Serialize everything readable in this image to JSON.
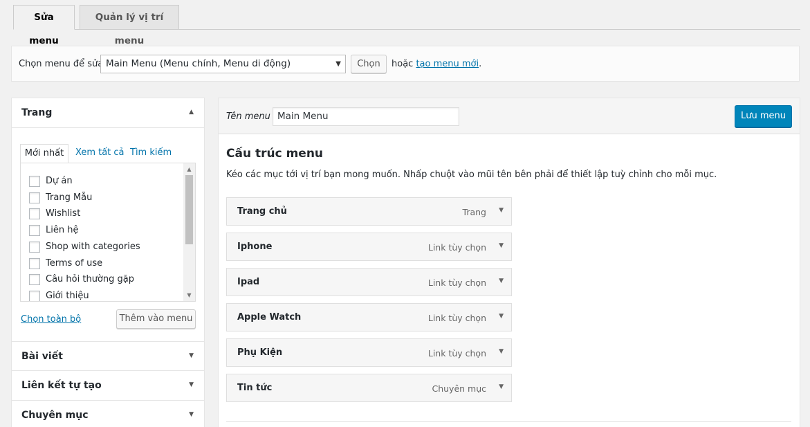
{
  "tabs": {
    "edit_menu": "Sửa menu",
    "manage_locations": "Quản lý vị trí menu"
  },
  "manage": {
    "label": "Chọn menu để sửa:",
    "selected": "Main Menu (Menu chính, Menu di động)",
    "select_button": "Chọn",
    "or_text": "hoặc",
    "create_link": "tạo menu mới",
    "period": "."
  },
  "sidebar": {
    "pages_title": "Trang",
    "inner_tabs": [
      "Mới nhất",
      "Xem tất cả",
      "Tìm kiếm"
    ],
    "pages": [
      "Dự án",
      "Trang Mẫu",
      "Wishlist",
      "Liên hệ",
      "Shop with categories",
      "Terms of use",
      "Câu hỏi thường gặp",
      "Giới thiệu"
    ],
    "select_all": "Chọn toàn bộ",
    "add_to_menu": "Thêm vào menu",
    "sections": [
      "Bài viết",
      "Liên kết tự tạo",
      "Chuyên mục"
    ]
  },
  "editor": {
    "name_label": "Tên menu",
    "name_value": "Main Menu",
    "save_button": "Lưu menu",
    "structure_title": "Cấu trúc menu",
    "structure_desc": "Kéo các mục tới vị trí bạn mong muốn. Nhấp chuột vào mũi tên bên phải để thiết lập tuỳ chỉnh cho mỗi mục.",
    "items": [
      {
        "title": "Trang chủ",
        "type": "Trang"
      },
      {
        "title": "Iphone",
        "type": "Link tùy chọn"
      },
      {
        "title": "Ipad",
        "type": "Link tùy chọn"
      },
      {
        "title": "Apple Watch",
        "type": "Link tùy chọn"
      },
      {
        "title": "Phụ Kiện",
        "type": "Link tùy chọn"
      },
      {
        "title": "Tin tức",
        "type": "Chuyên mục"
      }
    ]
  },
  "icons": {
    "collapse": "triangle-up-icon",
    "expand": "triangle-down-icon",
    "select_caret": "caret-down-icon"
  }
}
